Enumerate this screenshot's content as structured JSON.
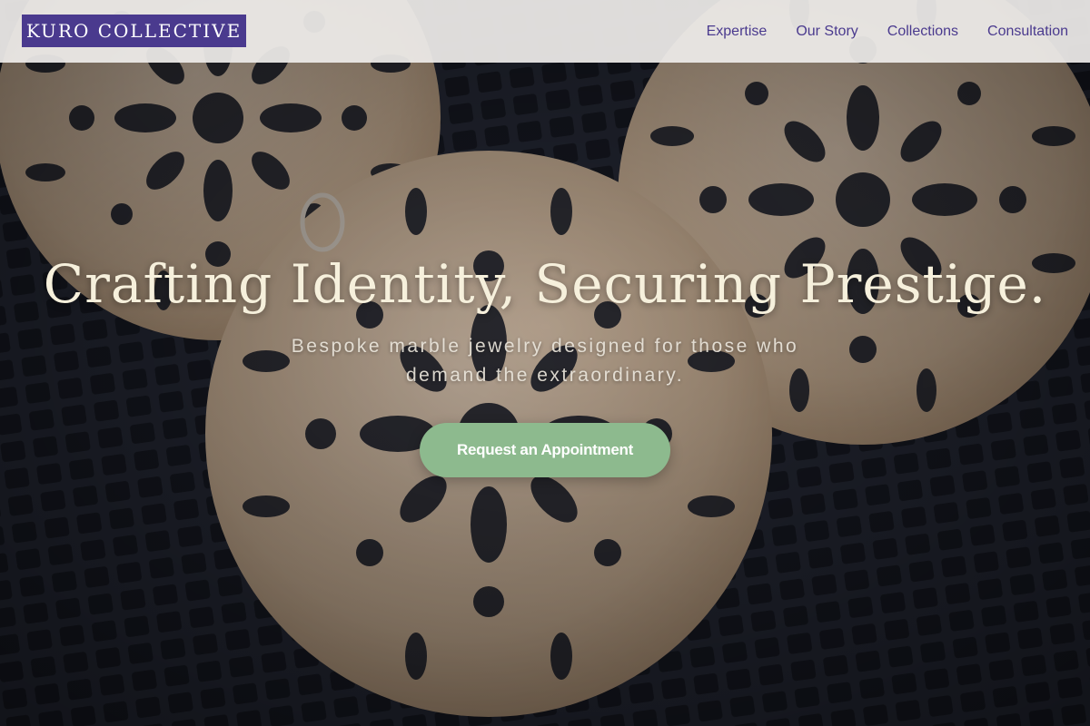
{
  "brand": {
    "name": "KURO COLLECTIVE",
    "accent_color": "#4a3a8e"
  },
  "nav": {
    "items": [
      {
        "label": "Expertise"
      },
      {
        "label": "Our Story"
      },
      {
        "label": "Collections"
      },
      {
        "label": "Consultation"
      }
    ]
  },
  "hero": {
    "title": "Crafting Identity, Securing Prestige.",
    "subtitle": "Bespoke marble jewelry designed for those who demand the extraordinary.",
    "cta_label": "Request an Appointment",
    "cta_color": "#8dba8e",
    "background_image": "filigree-gold-pendants-on-dark-mesh"
  }
}
